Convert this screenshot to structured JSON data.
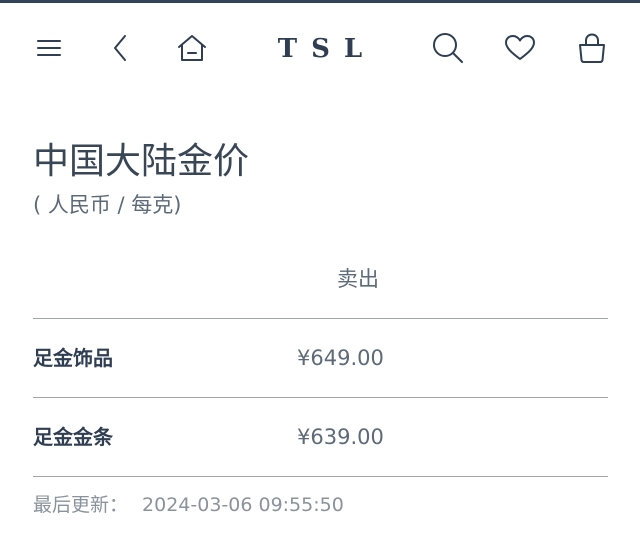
{
  "header": {
    "logo": "TSL"
  },
  "page": {
    "title": "中国大陆金价",
    "subtitle": "( 人民币 / 每克)"
  },
  "table": {
    "column_header": "卖出",
    "rows": [
      {
        "name": "足金饰品",
        "price": "¥649.00"
      },
      {
        "name": "足金金条",
        "price": "¥639.00"
      }
    ]
  },
  "footer": {
    "updated_label": "最后更新：",
    "updated_time": "2024-03-06 09:55:50"
  },
  "icons": [
    "menu-icon",
    "back-icon",
    "home-icon",
    "search-icon",
    "heart-icon",
    "shopping-bag-icon"
  ],
  "colors": {
    "text_primary": "#2f3e52",
    "text_secondary": "#5d6a78",
    "divider": "#9ea5ad",
    "top_rule": "#33435a"
  }
}
